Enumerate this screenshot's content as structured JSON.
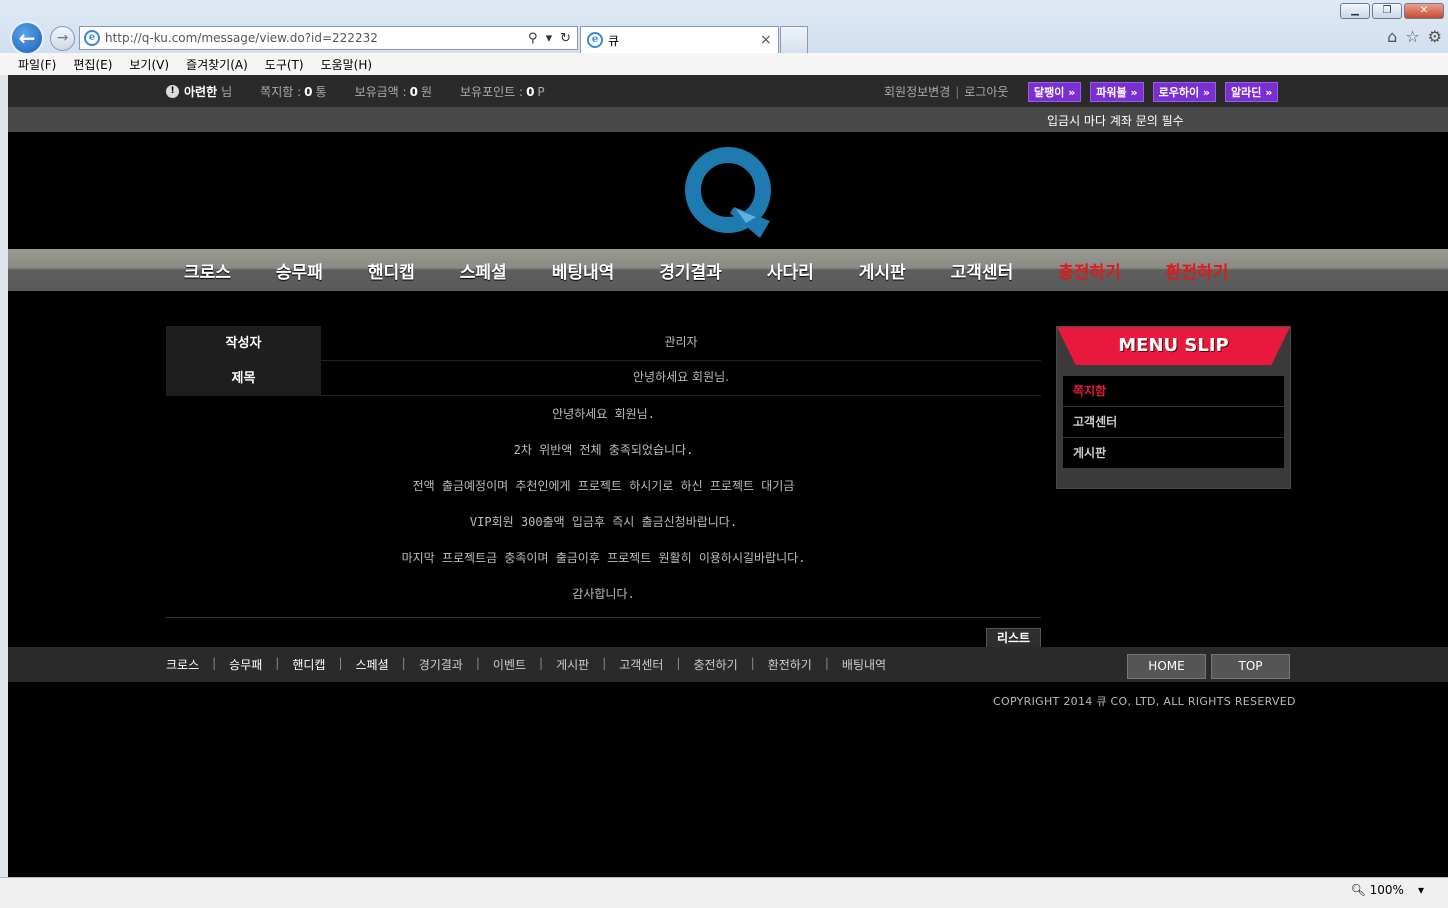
{
  "browser": {
    "url": "http://q-ku.com/message/view.do?id=222232",
    "tab_title": "큐",
    "menu": [
      "파일(F)",
      "편집(E)",
      "보기(V)",
      "즐겨찾기(A)",
      "도구(T)",
      "도움말(H)"
    ],
    "zoom": "100%"
  },
  "topbar": {
    "username": "아련한",
    "honorific": "님",
    "msg_label": "쪽지함 :",
    "msg_count": "0",
    "msg_unit": "통",
    "money_label": "보유금액 :",
    "money": "0",
    "money_unit": "원",
    "point_label": "보유포인트 :",
    "point": "0",
    "point_unit": "P",
    "edit_info": "회원정보변경",
    "logout": "로그아웃",
    "sites": [
      "달팽이 »",
      "파워볼 »",
      "로우하이 »",
      "알라딘 »"
    ]
  },
  "notice": "입금시 마다 계좌 문의 필수",
  "nav": [
    "크로스",
    "승무패",
    "핸디캡",
    "스페셜",
    "베팅내역",
    "경기결과",
    "사다리",
    "게시판",
    "고객센터",
    "충전하기",
    "환전하기"
  ],
  "message": {
    "author_label": "작성자",
    "author": "관리자",
    "title_label": "제목",
    "title": "안녕하세요 회원님.",
    "lines": [
      "안녕하세요 회원님.",
      "2차 위반액 전체 충족되었습니다.",
      "전액 출금예정이며 추천인에게 프로젝트 하시기로 하신 프로젝트 대기금",
      "VIP회원 300출액 입금후 즉시 출금신청바랍니다.",
      "마지막 프로젝트금 충족이며 출금이후 프로젝트 원활히 이용하시길바랍니다.",
      "감사합니다."
    ],
    "list_button": "리스트"
  },
  "slip": {
    "title": "MENU SLIP",
    "items": [
      "쪽지함",
      "고객센터",
      "게시판"
    ]
  },
  "footer": {
    "links": [
      "크로스",
      "승무패",
      "핸디캡",
      "스페셜",
      "경기결과",
      "이벤트",
      "게시판",
      "고객센터",
      "충전하기",
      "환전하기",
      "배팅내역"
    ],
    "home": "HOME",
    "top": "TOP",
    "copyright": "COPYRIGHT 2014 큐 CO, LTD, ALL RIGHTS RESERVED"
  },
  "colors": {
    "accent_red": "#e8193c",
    "site_button": "#7a2fd0",
    "logo_blue": "#1f7ab0"
  }
}
